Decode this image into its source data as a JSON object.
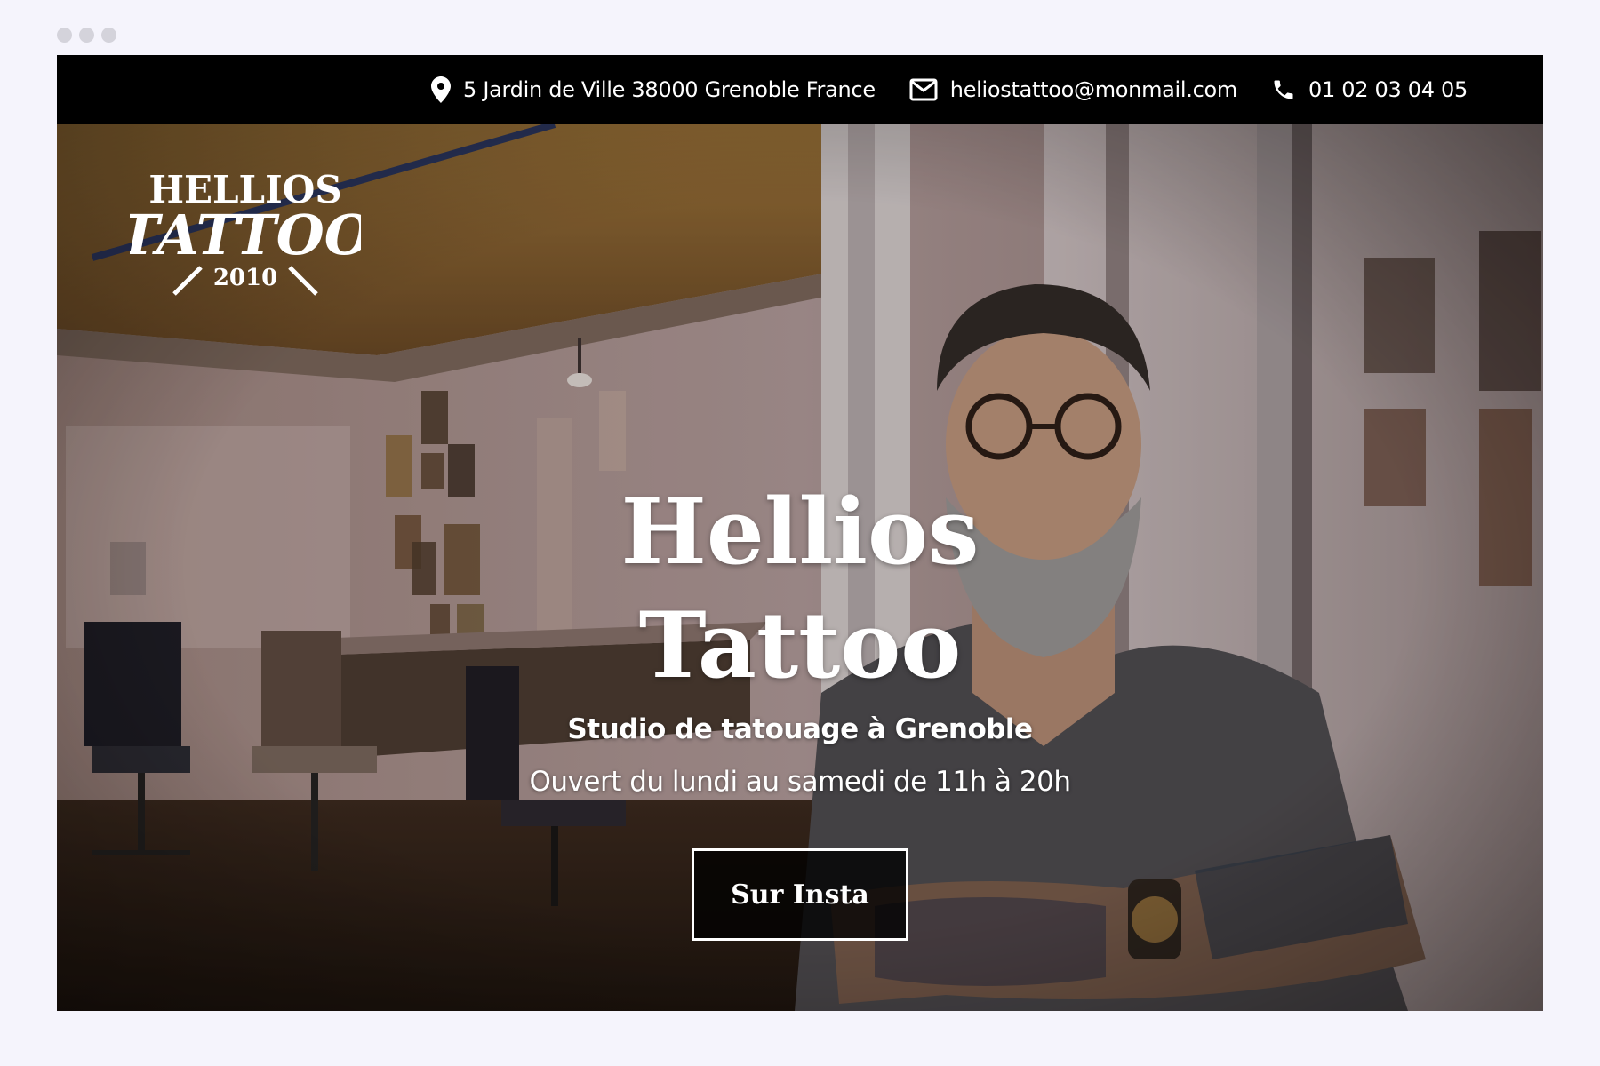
{
  "topbar": {
    "address": "5 Jardin de Ville 38000 Grenoble France",
    "email": "heliostattoo@monmail.com",
    "phone": "01 02 03 04 05",
    "icons": [
      "location-pin-icon",
      "mail-icon",
      "phone-icon"
    ]
  },
  "logo": {
    "line1": "HELLIOS",
    "line2": "TATTOO",
    "year": "2010"
  },
  "hero": {
    "title_line1": "Hellios",
    "title_line2": "Tattoo",
    "subtitle": "Studio de tatouage à Grenoble",
    "hours": "Ouvert du lundi au samedi de 11h à 20h",
    "cta_label": "Sur Insta"
  },
  "colors": {
    "topbar_bg": "#000000",
    "text": "#ffffff",
    "page_bg": "#f5f4fc",
    "button_bg": "#000000"
  }
}
